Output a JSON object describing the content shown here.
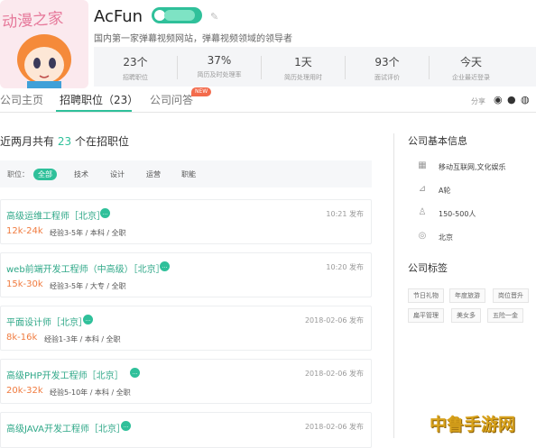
{
  "header": {
    "logo_text": "动漫之家",
    "company_name": "AcFun",
    "slogan": "国内第一家弹幕视频网站，弹幕视频领域的领导者",
    "stats": [
      {
        "value": "23个",
        "label": "招聘职位"
      },
      {
        "value": "37%",
        "label": "简历及时处理率"
      },
      {
        "value": "1天",
        "label": "简历处理用时"
      },
      {
        "value": "93个",
        "label": "面试评价"
      },
      {
        "value": "今天",
        "label": "企业最近登录"
      }
    ]
  },
  "tabs": {
    "items": [
      {
        "label": "公司主页"
      },
      {
        "label": "招聘职位（23）"
      },
      {
        "label": "公司问答"
      }
    ],
    "new_badge": "NEW",
    "share_label": "分享"
  },
  "jobs_section": {
    "title_prefix": "近两月共有",
    "title_count": "23",
    "title_suffix": "个在招职位",
    "filter_label": "职位：",
    "filters": [
      "全部",
      "技术",
      "设计",
      "运营",
      "职能"
    ],
    "jobs": [
      {
        "title": "高级运维工程师［北京］",
        "time": "10:21 发布",
        "salary": "12k-24k",
        "requirements": "经验3-5年 / 本科 / 全职"
      },
      {
        "title": "web前端开发工程师（中高级）［北京］",
        "time": "10:20 发布",
        "salary": "15k-30k",
        "requirements": "经验3-5年 / 大专 / 全职"
      },
      {
        "title": "平面设计师［北京］",
        "time": "2018-02-06 发布",
        "salary": "8k-16k",
        "requirements": "经验1-3年 / 本科 / 全职"
      },
      {
        "title": "高级PHP开发工程师［北京］",
        "time": "2018-02-06 发布",
        "salary": "20k-32k",
        "requirements": "经验5-10年 / 本科 / 全职"
      },
      {
        "title": "高级JAVA开发工程师［北京］",
        "time": "2018-02-06 发布",
        "salary": "",
        "requirements": ""
      }
    ]
  },
  "company_info": {
    "title": "公司基本信息",
    "items": [
      {
        "icon": "industry-icon",
        "text": "移动互联网,文化娱乐"
      },
      {
        "icon": "financing-icon",
        "text": "A轮"
      },
      {
        "icon": "people-icon",
        "text": "150-500人"
      },
      {
        "icon": "location-icon",
        "text": "北京"
      }
    ]
  },
  "company_tags": {
    "title": "公司标签",
    "tags": [
      "节日礼物",
      "年度旅游",
      "岗位晋升",
      "扁平管理",
      "美女多",
      "五险一金"
    ]
  },
  "watermark": "中鲁手游网",
  "colors": {
    "accent": "#2fc09a",
    "salary": "#f07b3f",
    "new_badge": "#f36b4c"
  }
}
